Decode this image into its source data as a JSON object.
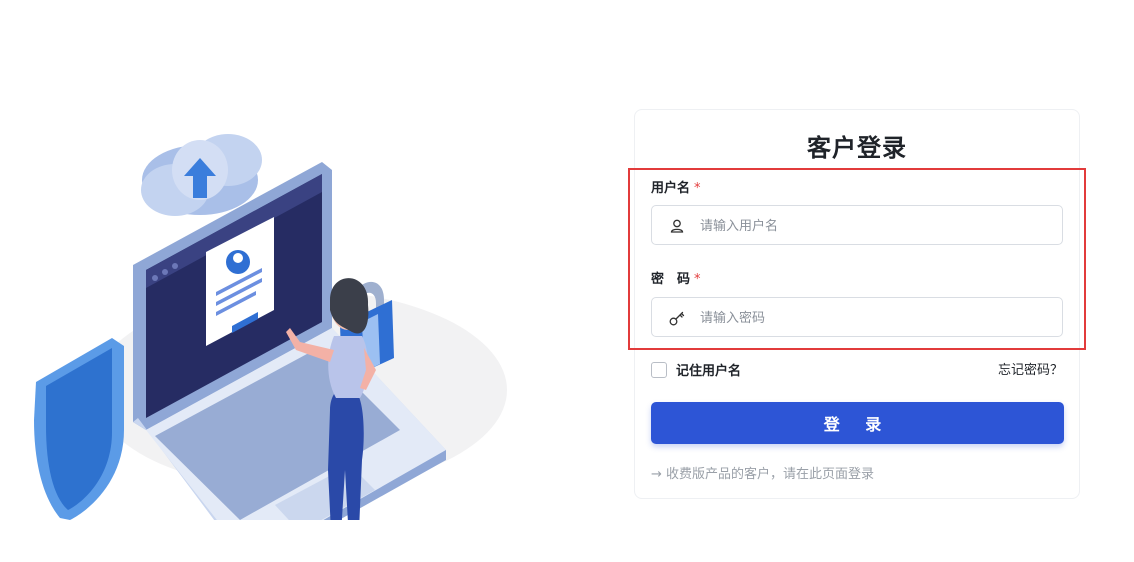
{
  "login": {
    "title": "客户登录",
    "username_label": "用户名",
    "username_placeholder": "请输入用户名",
    "password_label": "密　码",
    "password_placeholder": "请输入密码",
    "required_mark": "*",
    "remember_label": "记住用户名",
    "remember_checked": false,
    "forgot_link": "忘记密码？",
    "submit_label": "登 录",
    "hint_arrow": "→",
    "hint_text": "收费版产品的客户，请在此页面登录"
  },
  "icons": {
    "username": "user-icon",
    "password": "key-icon"
  },
  "colors": {
    "primary": "#2d55d6",
    "highlight_border": "#e23b3b",
    "required": "#e23b3b"
  }
}
